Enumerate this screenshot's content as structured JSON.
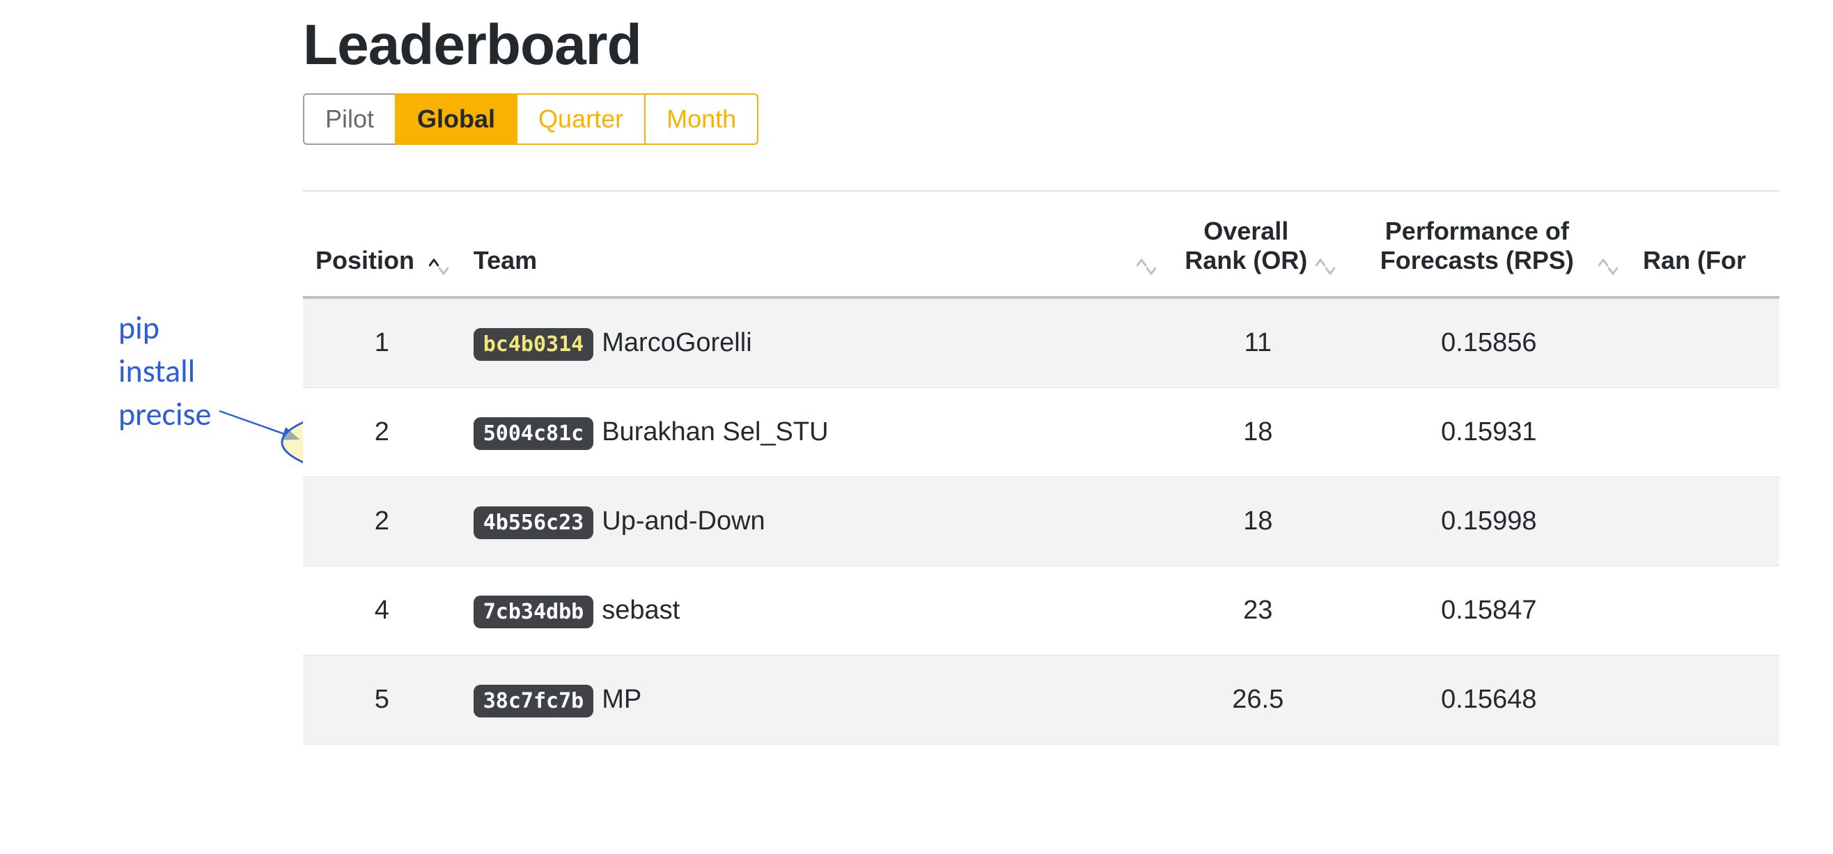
{
  "page_title": "Leaderboard",
  "tabs": [
    {
      "label": "Pilot",
      "active": false,
      "muted": true
    },
    {
      "label": "Global",
      "active": true
    },
    {
      "label": "Quarter",
      "active": false
    },
    {
      "label": "Month",
      "active": false
    }
  ],
  "columns": {
    "position": "Position",
    "team": "Team",
    "or": "Overall Rank (OR)",
    "rps": "Performance of Forecasts (RPS)",
    "ran": "Ran (For"
  },
  "rows": [
    {
      "position": "1",
      "hash": "bc4b0314",
      "team": "MarcoGorelli",
      "or": "11",
      "rps": "0.15856",
      "hl": true
    },
    {
      "position": "2",
      "hash": "5004c81c",
      "team": "Burakhan Sel_STU",
      "or": "18",
      "rps": "0.15931"
    },
    {
      "position": "2",
      "hash": "4b556c23",
      "team": "Up-and-Down",
      "or": "18",
      "rps": "0.15998"
    },
    {
      "position": "4",
      "hash": "7cb34dbb",
      "team": "sebast",
      "or": "23",
      "rps": "0.15847"
    },
    {
      "position": "5",
      "hash": "38c7fc7b",
      "team": "MP",
      "or": "26.5",
      "rps": "0.15648"
    }
  ],
  "annotation": {
    "line1": "pip",
    "line2": "install",
    "line3": "precise"
  }
}
